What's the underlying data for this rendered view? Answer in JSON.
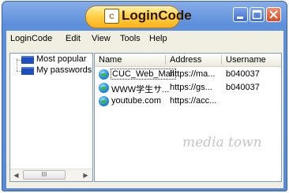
{
  "window": {
    "title": "LoginCode",
    "icon_letter": "C",
    "controls": [
      "minimize-icon",
      "maximize-icon",
      "close-icon"
    ]
  },
  "menu": {
    "items": [
      "LoginCode",
      "Edit",
      "View",
      "Tools",
      "Help"
    ]
  },
  "tree": {
    "items": [
      "Most popular",
      "My passwords"
    ],
    "scroll_thumb_glyph": "III"
  },
  "list": {
    "columns": [
      "Name",
      "Address",
      "Username"
    ],
    "rows": [
      {
        "name": "CUC_Web_Mail",
        "address": "https://ma...",
        "username": "b040037"
      },
      {
        "name": "WWW学生サ...",
        "address": "https://gs...",
        "username": "b040037"
      },
      {
        "name": "youtube.com",
        "address": "https://acc...",
        "username": ""
      }
    ]
  },
  "watermark": "media town"
}
